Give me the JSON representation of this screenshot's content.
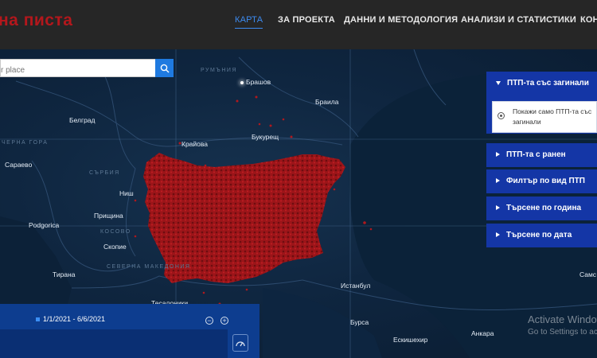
{
  "header": {
    "logo": "на писта",
    "nav": [
      {
        "label": "КАРТА",
        "active": true
      },
      {
        "label": "ЗА ПРОЕКТА"
      },
      {
        "label": "ДАННИ И МЕТОДОЛОГИЯ"
      },
      {
        "label": "АНАЛИЗИ И СТАТИСТИКИ"
      },
      {
        "label": "КОН"
      }
    ]
  },
  "search": {
    "placeholder": "r place",
    "icon": "search-icon"
  },
  "map": {
    "regions": [
      "РУМЪНИЯ",
      "ЧЕРНА ГОРА",
      "СЪРБИЯ",
      "КОСОВО",
      "СЕВЕРНА МАКЕДОНИЯ"
    ],
    "cities": [
      "Брашов",
      "Белград",
      "Браила",
      "Крайова",
      "Букурещ",
      "Сараево",
      "Ниш",
      "Прищина",
      "Podgorica",
      "Скопие",
      "Тирана",
      "Истанбул",
      "Тесалоники",
      "Бурса",
      "Ескишехир",
      "Анкара",
      "Самс"
    ],
    "accident_color": "#a3161b"
  },
  "panel": {
    "sections": [
      {
        "label": "ПТП-та със загинали",
        "expanded": true
      },
      {
        "label": "ПТП-та с ранен"
      },
      {
        "label": "Филтър по вид ПТП"
      },
      {
        "label": "Търсене по година"
      },
      {
        "label": "Търсене по дата"
      }
    ],
    "option": "Покажи само ПТП-та със загинали"
  },
  "timeline": {
    "range": "1/1/2021 - 6/6/2021"
  },
  "watermark": {
    "line1": "Activate Windows",
    "line2": "Go to Settings to activate Windows."
  },
  "colors": {
    "header_bg": "#262626",
    "accent": "#3d8bf0",
    "panel": "#1436a6",
    "logo": "#b3171c"
  }
}
